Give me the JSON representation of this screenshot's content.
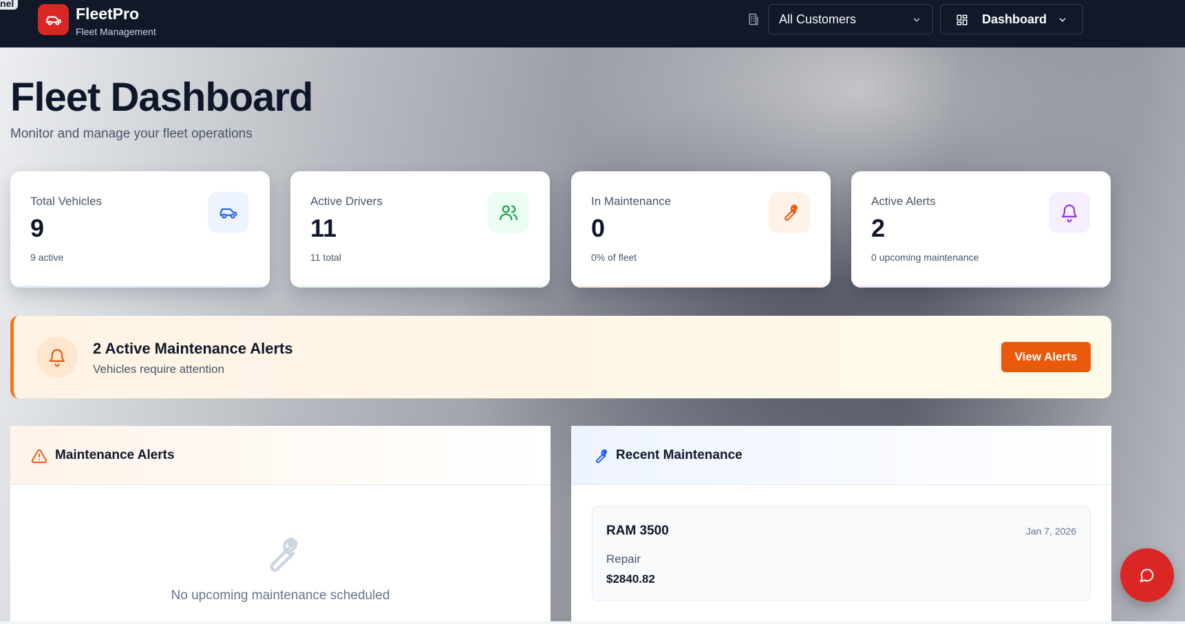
{
  "corner_tag": "nel",
  "brand": {
    "name": "FleetPro",
    "subtitle": "Fleet Management"
  },
  "header": {
    "customer_select": {
      "value": "All Customers"
    },
    "view_button": {
      "label": "Dashboard"
    }
  },
  "page": {
    "title": "Fleet Dashboard",
    "subtitle": "Monitor and manage your fleet operations"
  },
  "stats": [
    {
      "label": "Total Vehicles",
      "value": "9",
      "note": "9 active",
      "icon": "car-icon",
      "accent": "#2563eb"
    },
    {
      "label": "Active Drivers",
      "value": "11",
      "note": "11 total",
      "icon": "users-icon",
      "accent": "#16a34a"
    },
    {
      "label": "In Maintenance",
      "value": "0",
      "note": "0% of fleet",
      "icon": "wrench-icon",
      "accent": "#ea580c"
    },
    {
      "label": "Active Alerts",
      "value": "2",
      "note": "0 upcoming maintenance",
      "icon": "bell-icon",
      "accent": "#9333ea"
    }
  ],
  "banner": {
    "title": "2 Active Maintenance Alerts",
    "subtitle": "Vehicles require attention",
    "button_label": "View Alerts"
  },
  "maintenance_alerts": {
    "title": "Maintenance Alerts",
    "empty_text": "No upcoming maintenance scheduled"
  },
  "recent_maintenance": {
    "title": "Recent Maintenance",
    "items": [
      {
        "vehicle": "RAM 3500",
        "date": "Jan 7, 2026",
        "type": "Repair",
        "cost": "$2840.82"
      }
    ]
  },
  "colors": {
    "nav_bg": "#111827",
    "brand_red": "#dc2626",
    "cta_orange": "#ea580c"
  }
}
